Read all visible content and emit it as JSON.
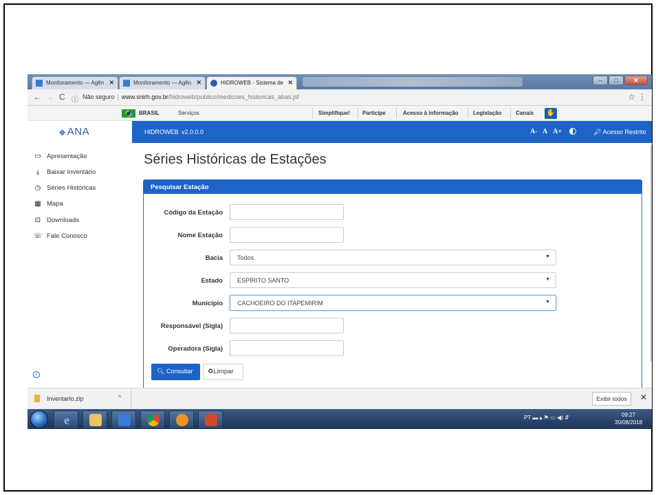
{
  "browser": {
    "tabs": [
      {
        "title": "Monitoramento — Agên",
        "active": false
      },
      {
        "title": "Monitoramento — Agên",
        "active": false
      },
      {
        "title": "HIDROWEB - Sistema de",
        "active": true
      }
    ],
    "address": {
      "security_label": "Não seguro",
      "domain": "www.snirh.gov.br",
      "path": "/hidroweb/publico/medicoes_historicas_abas.jsf"
    }
  },
  "govbar": {
    "country": "BRASIL",
    "services": "Serviços",
    "links": [
      "Simplifique!",
      "Participe",
      "Acesso à informação",
      "Legislação",
      "Canais"
    ]
  },
  "app": {
    "logo_text": "ANA",
    "system_name": "HIDROWEB",
    "version": "v2.0.0.0",
    "font_controls": [
      "A-",
      "A",
      "A+"
    ],
    "restricted_access": "Acesso Restrito"
  },
  "sidebar": {
    "items": [
      {
        "label": "Apresentação",
        "icon": "presentation-icon"
      },
      {
        "label": "Baixar Inventário",
        "icon": "download-icon"
      },
      {
        "label": "Séries Históricas",
        "icon": "history-icon"
      },
      {
        "label": "Mapa",
        "icon": "map-icon"
      },
      {
        "label": "Downloads",
        "icon": "downloads-icon"
      },
      {
        "label": "Fale Conosco",
        "icon": "contact-icon"
      }
    ]
  },
  "main": {
    "title": "Séries Históricas de Estações",
    "panel_title": "Pesquisar Estação",
    "fields": {
      "codigo": {
        "label": "Código da Estação",
        "value": ""
      },
      "nome": {
        "label": "Nome Estação",
        "value": ""
      },
      "bacia": {
        "label": "Bacia",
        "value": "Todos"
      },
      "estado": {
        "label": "Estado",
        "value": "ESPÍRITO SANTO"
      },
      "municipio": {
        "label": "Município",
        "value": "CACHOEIRO DO ITAPEMIRIM"
      },
      "responsavel": {
        "label": "Responsável (Sigla)",
        "value": ""
      },
      "operadora": {
        "label": "Operadora (Sigla)",
        "value": ""
      }
    },
    "buttons": {
      "consultar": "Consultar",
      "limpar": "Limpar"
    }
  },
  "downloads_bar": {
    "file_name": "Inventario.zip",
    "show_all": "Exibir todos"
  },
  "taskbar": {
    "language": "PT",
    "time": "09:27",
    "date": "30/08/2018"
  },
  "colors": {
    "primary": "#1d63c8",
    "taskbar": "#1e3557"
  }
}
